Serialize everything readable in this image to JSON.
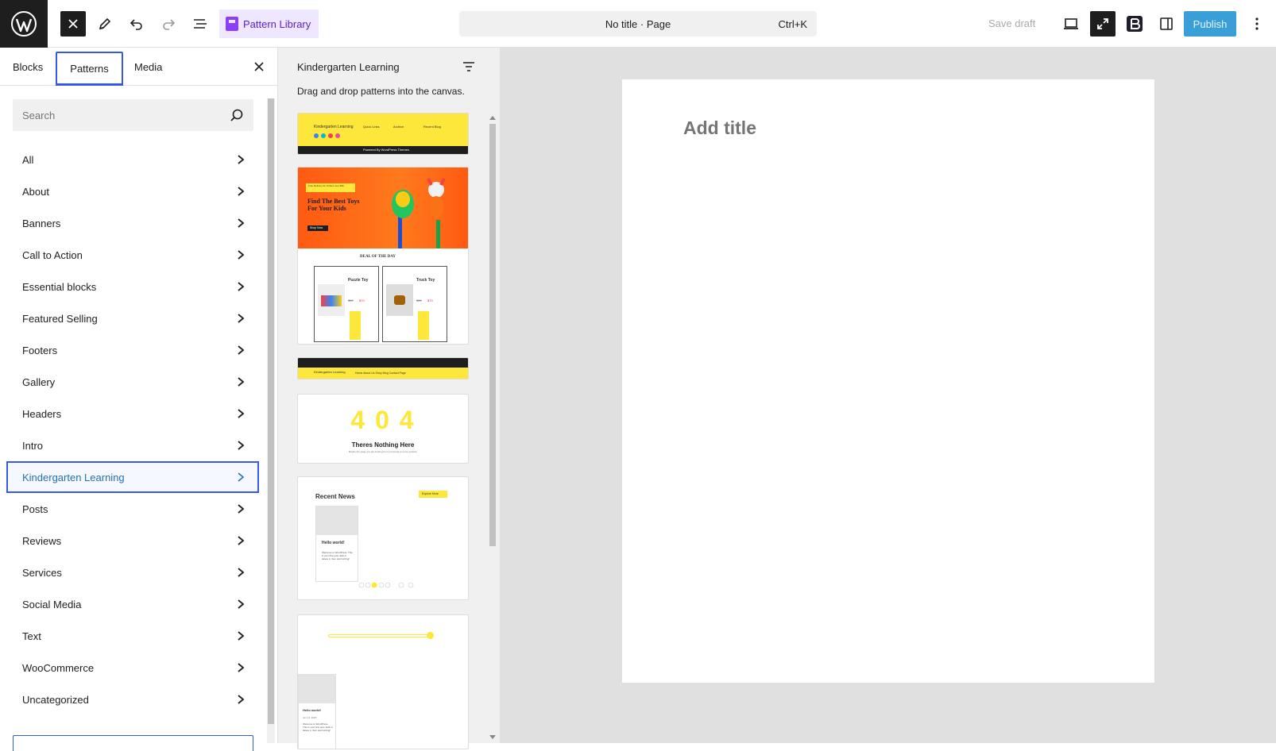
{
  "topbar": {
    "pattern_library_label": "Pattern Library",
    "doc_title": "No title · Page",
    "shortcut": "Ctrl+K",
    "save_draft_label": "Save draft",
    "publish_label": "Publish"
  },
  "inserter": {
    "tabs": {
      "blocks": "Blocks",
      "patterns": "Patterns",
      "media": "Media"
    },
    "search_placeholder": "Search",
    "categories": [
      "All",
      "About",
      "Banners",
      "Call to Action",
      "Essential blocks",
      "Featured Selling",
      "Footers",
      "Gallery",
      "Headers",
      "Intro",
      "Kindergarten Learning",
      "Posts",
      "Reviews",
      "Services",
      "Social Media",
      "Text",
      "WooCommerce",
      "Uncategorized"
    ],
    "active_category": "Kindergarten Learning"
  },
  "patterns_panel": {
    "title": "Kindergarten Learning",
    "hint": "Drag and drop patterns into the canvas.",
    "card1": {
      "brand": "Kindergarten Learning",
      "col1": "Quick Links",
      "col2": "Archive",
      "col3": "Recent Blog",
      "footer": "Powered By WordPress Themes"
    },
    "card2": {
      "badge": "Free Delivery for Orders over $99",
      "heading": "Find The Best Toys For Your Kids",
      "button": "Shop Now",
      "deal": "DEAL OF THE DAY",
      "product1": "Puzzle Toy",
      "product2": "Truck Toy",
      "price_old": "$60",
      "price_new": "$70"
    },
    "card3": {
      "brand": "Kindergarten Learning",
      "nav": "Home   About Us   Shop   Blog   Contact   Page"
    },
    "card4": {
      "code": "4 0 4",
      "heading": "Theres Nothing Here",
      "sub": "Maybe the page you are looking for is not found or never existed."
    },
    "card5": {
      "heading": "Recent News",
      "button": "Explore More",
      "post_title": "Hello world!",
      "post_body": "Welcome to WordPress. This is your first post. Edit or delete it, then start writing!"
    },
    "card6": {
      "post_title": "Hello world!",
      "date": "Jun 14, 2025",
      "post_body": "Welcome to WordPress. This is your first post. Edit or delete it, then start writing!"
    }
  },
  "editor": {
    "title_placeholder": "Add title"
  },
  "colors": {
    "accent": "#3858e9",
    "pattern_yellow": "#fde73a",
    "banner_orange": "#ff6a1f",
    "publish": "#3a9fd6"
  }
}
